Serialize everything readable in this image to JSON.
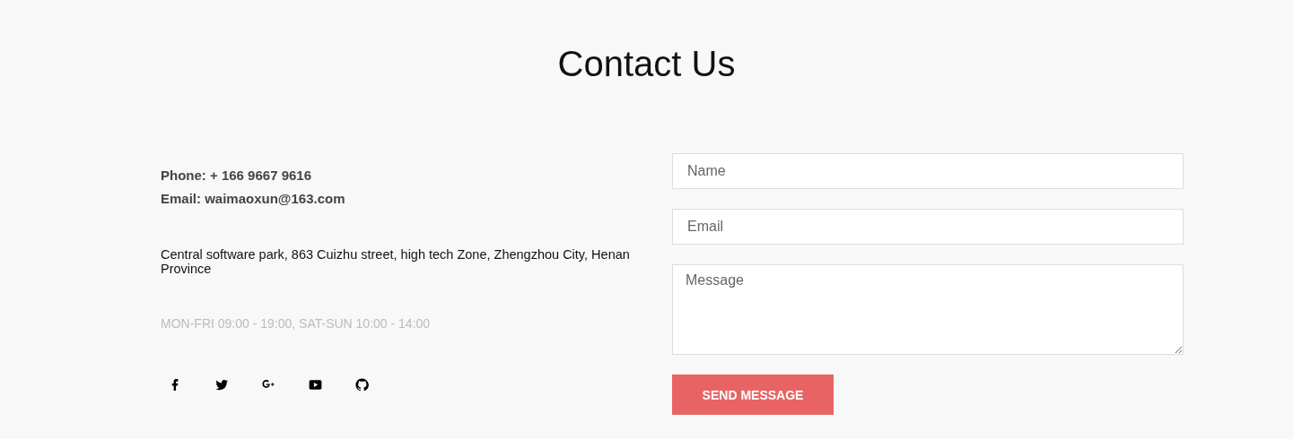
{
  "title": "Contact Us",
  "contact": {
    "phone": "Phone: + 166 9667 9616",
    "email": "Email: waimaoxun@163.com",
    "address": "Central software park, 863 Cuizhu street, high tech Zone, Zhengzhou City, Henan Province",
    "hours": "MON-FRI 09:00 - 19:00, SAT-SUN 10:00 - 14:00"
  },
  "social": [
    {
      "kind": "facebook"
    },
    {
      "kind": "twitter"
    },
    {
      "kind": "google-plus"
    },
    {
      "kind": "youtube"
    },
    {
      "kind": "github"
    }
  ],
  "form": {
    "fields": [
      {
        "kind": "input",
        "placeholder": "Name"
      },
      {
        "kind": "input",
        "placeholder": "Email"
      },
      {
        "kind": "textarea",
        "placeholder": "Message"
      }
    ],
    "button": "SEND MESSAGE"
  }
}
